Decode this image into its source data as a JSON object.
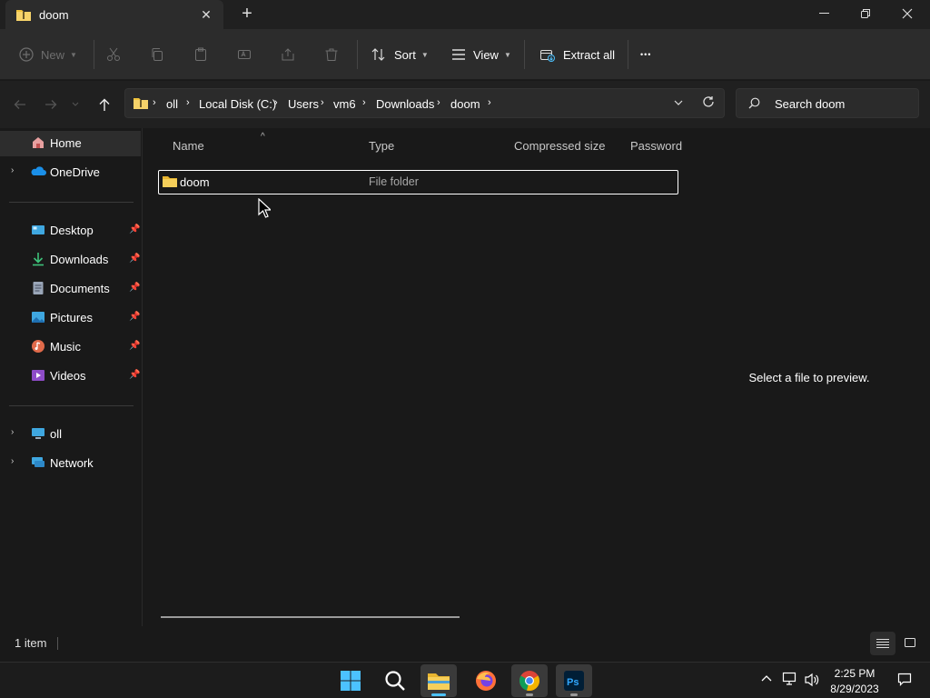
{
  "window": {
    "tab_title": "doom",
    "close_tab_glyph": "✕",
    "new_tab_glyph": "+"
  },
  "toolbar": {
    "new_label": "New",
    "sort_label": "Sort",
    "view_label": "View",
    "extract_all_label": "Extract all",
    "more_glyph": "•••"
  },
  "address": {
    "breadcrumbs": [
      "oll",
      "Local Disk (C:)",
      "Users",
      "vm6",
      "Downloads",
      "doom"
    ]
  },
  "search": {
    "placeholder": "Search doom"
  },
  "sidebar": {
    "home": "Home",
    "onedrive": "OneDrive",
    "quick_access": [
      {
        "label": "Desktop",
        "icon": "desktop-icon"
      },
      {
        "label": "Downloads",
        "icon": "downloads-icon"
      },
      {
        "label": "Documents",
        "icon": "documents-icon"
      },
      {
        "label": "Pictures",
        "icon": "pictures-icon"
      },
      {
        "label": "Music",
        "icon": "music-icon"
      },
      {
        "label": "Videos",
        "icon": "videos-icon"
      }
    ],
    "this_pc": "oll",
    "network": "Network"
  },
  "columns": {
    "name": "Name",
    "type": "Type",
    "compressed_size": "Compressed size",
    "password": "Password"
  },
  "files": [
    {
      "name": "doom",
      "type": "File folder"
    }
  ],
  "preview": {
    "message": "Select a file to preview."
  },
  "status": {
    "item_count": "1 item"
  },
  "taskbar": {
    "time": "2:25 PM",
    "date": "8/29/2023"
  },
  "colors": {
    "folder_yellow": "#f0c33c",
    "accent_blue": "#4cc2ff",
    "background": "#191919"
  }
}
